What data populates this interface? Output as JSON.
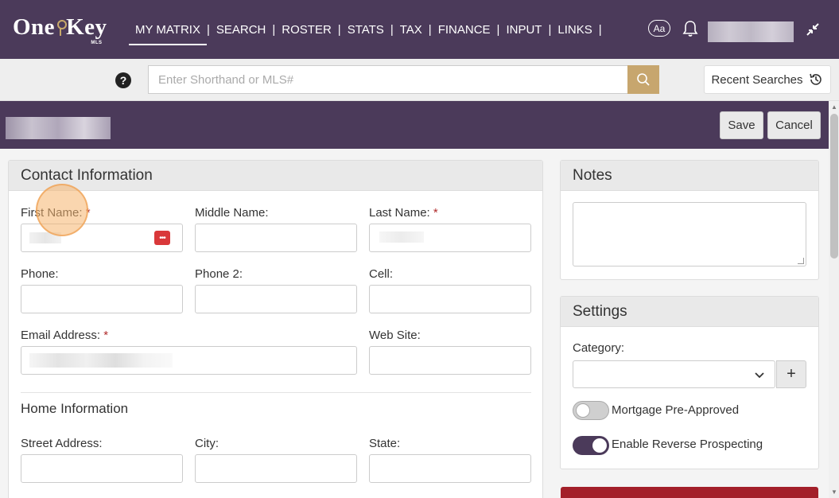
{
  "brand": {
    "name": "One Key",
    "sub": "MLS",
    "accent": "#c7a66e",
    "primary": "#4b3a5a"
  },
  "nav": {
    "items": [
      "MY MATRIX",
      "SEARCH",
      "ROSTER",
      "STATS",
      "TAX",
      "FINANCE",
      "INPUT",
      "LINKS"
    ],
    "font_button": "Aa"
  },
  "search": {
    "placeholder": "Enter Shorthand or MLS#",
    "help": "?",
    "recent_label": "Recent Searches"
  },
  "header": {
    "save_label": "Save",
    "cancel_label": "Cancel"
  },
  "contact": {
    "title": "Contact Information",
    "first_name_label": "First Name:",
    "middle_name_label": "Middle Name:",
    "last_name_label": "Last Name:",
    "phone_label": "Phone:",
    "phone2_label": "Phone 2:",
    "cell_label": "Cell:",
    "email_label": "Email Address:",
    "website_label": "Web Site:",
    "required_mark": "*",
    "home_title": "Home Information",
    "street_label": "Street Address:",
    "city_label": "City:",
    "state_label": "State:"
  },
  "notes": {
    "title": "Notes"
  },
  "settings": {
    "title": "Settings",
    "category_label": "Category:",
    "add_label": "+",
    "mortgage_label": "Mortgage Pre-Approved",
    "mortgage_on": false,
    "reverse_label": "Enable Reverse Prospecting",
    "reverse_on": true
  }
}
